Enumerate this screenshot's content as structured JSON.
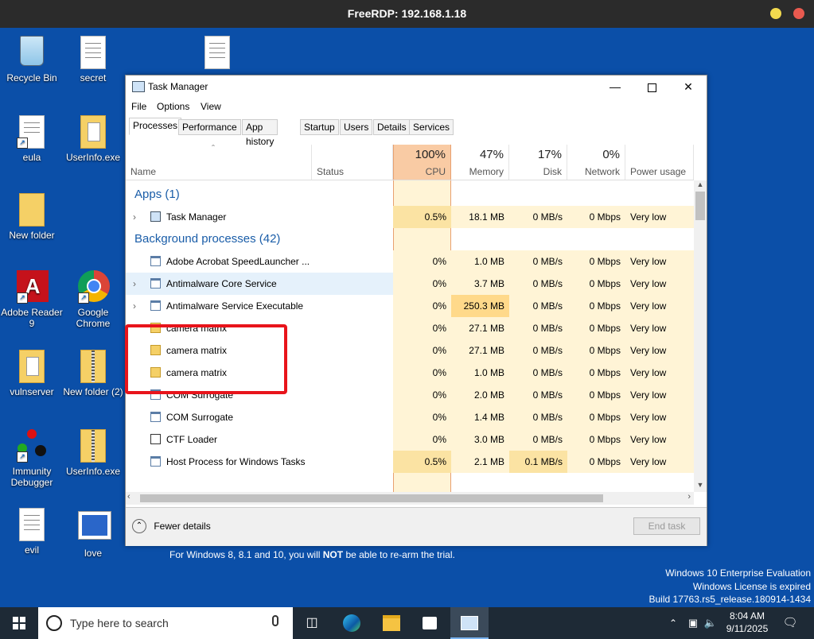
{
  "rdp": {
    "title": "FreeRDP: 192.168.1.18"
  },
  "desktop_icons": [
    {
      "label": "Recycle Bin"
    },
    {
      "label": "secret"
    },
    {
      "label": "eula"
    },
    {
      "label": "UserInfo.exe"
    },
    {
      "label": "New folder"
    },
    {
      "label": "Adobe Reader 9"
    },
    {
      "label": "Google Chrome"
    },
    {
      "label": "vulnserver"
    },
    {
      "label": "New folder (2)"
    },
    {
      "label": "Immunity Debugger"
    },
    {
      "label": "UserInfo.exe"
    },
    {
      "label": "evil"
    },
    {
      "label": "love"
    }
  ],
  "taskmgr": {
    "title": "Task Manager",
    "menu": [
      "File",
      "Options",
      "View"
    ],
    "tabs": [
      "Processes",
      "Performance",
      "App history",
      "Startup",
      "Users",
      "Details",
      "Services"
    ],
    "active_tab": "Processes",
    "columns": {
      "name": "Name",
      "status": "Status",
      "cpu_pct": "100%",
      "cpu": "CPU",
      "mem_pct": "47%",
      "memory": "Memory",
      "disk_pct": "17%",
      "disk": "Disk",
      "net_pct": "0%",
      "network": "Network",
      "power": "Power usage"
    },
    "groups": {
      "apps": "Apps (1)",
      "background": "Background processes (42)"
    },
    "apps": [
      {
        "name": "Task Manager",
        "cpu": "0.5%",
        "mem": "18.1 MB",
        "disk": "0 MB/s",
        "net": "0 Mbps",
        "power": "Very low"
      }
    ],
    "background": [
      {
        "name": "Adobe Acrobat SpeedLauncher ...",
        "cpu": "0%",
        "mem": "1.0 MB",
        "disk": "0 MB/s",
        "net": "0 Mbps",
        "power": "Very low"
      },
      {
        "name": "Antimalware Core Service",
        "cpu": "0%",
        "mem": "3.7 MB",
        "disk": "0 MB/s",
        "net": "0 Mbps",
        "power": "Very low"
      },
      {
        "name": "Antimalware Service Executable",
        "cpu": "0%",
        "mem": "250.3 MB",
        "disk": "0 MB/s",
        "net": "0 Mbps",
        "power": "Very low"
      },
      {
        "name": "camera matrix",
        "cpu": "0%",
        "mem": "27.1 MB",
        "disk": "0 MB/s",
        "net": "0 Mbps",
        "power": "Very low"
      },
      {
        "name": "camera matrix",
        "cpu": "0%",
        "mem": "27.1 MB",
        "disk": "0 MB/s",
        "net": "0 Mbps",
        "power": "Very low"
      },
      {
        "name": "camera matrix",
        "cpu": "0%",
        "mem": "1.0 MB",
        "disk": "0 MB/s",
        "net": "0 Mbps",
        "power": "Very low"
      },
      {
        "name": "COM Surrogate",
        "cpu": "0%",
        "mem": "2.0 MB",
        "disk": "0 MB/s",
        "net": "0 Mbps",
        "power": "Very low"
      },
      {
        "name": "COM Surrogate",
        "cpu": "0%",
        "mem": "1.4 MB",
        "disk": "0 MB/s",
        "net": "0 Mbps",
        "power": "Very low"
      },
      {
        "name": "CTF Loader",
        "cpu": "0%",
        "mem": "3.0 MB",
        "disk": "0 MB/s",
        "net": "0 Mbps",
        "power": "Very low"
      },
      {
        "name": "Host Process for Windows Tasks",
        "cpu": "0.5%",
        "mem": "2.1 MB",
        "disk": "0.1 MB/s",
        "net": "0 Mbps",
        "power": "Very low"
      }
    ],
    "fewer_details": "Fewer details",
    "end_task": "End task"
  },
  "desktop_text": {
    "prefix": "For Windows 8, 8.1 and 10, you will ",
    "bold": "NOT",
    "suffix": " be able to re-arm the trial."
  },
  "watermark": [
    "Windows 10 Enterprise Evaluation",
    "Windows License is expired",
    "Build 17763.rs5_release.180914-1434"
  ],
  "taskbar": {
    "search_placeholder": "Type here to search",
    "time": "8:04 AM",
    "date": "9/11/2025"
  },
  "colors": {
    "accent_highlight": "#e8141b",
    "cpu_header": "#f9cba4",
    "memory_heat": "#ffd98a",
    "desktop": "#0b4fa8"
  }
}
